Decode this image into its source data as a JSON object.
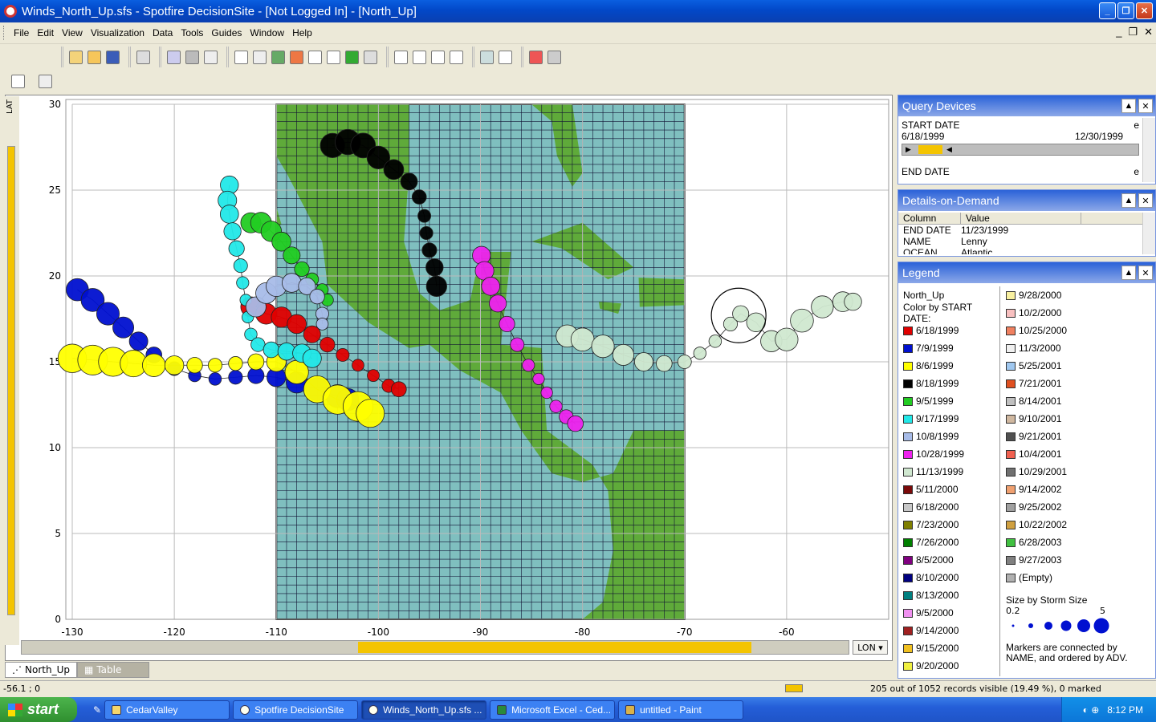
{
  "window": {
    "title": "Winds_North_Up.sfs - Spotfire DecisionSite - [Not Logged In] - [North_Up]"
  },
  "menu": [
    "File",
    "Edit",
    "View",
    "Visualization",
    "Data",
    "Tools",
    "Guides",
    "Window",
    "Help"
  ],
  "axes": {
    "y_label": "LAT",
    "x_label": "LON",
    "y_ticks": [
      "30",
      "25",
      "20",
      "15",
      "10",
      "5",
      "0"
    ],
    "x_ticks": [
      "-130",
      "-120",
      "-110",
      "-100",
      "-90",
      "-80",
      "-70",
      "-60"
    ]
  },
  "tabs": [
    {
      "label": "North_Up"
    },
    {
      "label": "Table"
    }
  ],
  "status": {
    "coord": "-56.1 ; 0",
    "records": "205 out of 1052 records visible (19.49 %), 0 marked"
  },
  "query_devices": {
    "title": "Query Devices",
    "start_label": "START DATE",
    "start_min": "6/18/1999",
    "start_max": "12/30/1999",
    "start_flag": "e",
    "end_label": "END DATE",
    "end_flag": "e"
  },
  "details": {
    "title": "Details-on-Demand",
    "col_header": "Column",
    "val_header": "Value",
    "rows": [
      {
        "c": "END DATE",
        "v": "11/23/1999"
      },
      {
        "c": "NAME",
        "v": "Lenny"
      },
      {
        "c": "OCEAN",
        "v": "Atlantic"
      }
    ]
  },
  "legend": {
    "title": "Legend",
    "view": "North_Up",
    "color_by": "Color by START DATE:",
    "left": [
      {
        "label": "6/18/1999",
        "color": "#e00000"
      },
      {
        "label": "7/9/1999",
        "color": "#0010d0"
      },
      {
        "label": "8/6/1999",
        "color": "#ffff00"
      },
      {
        "label": "8/18/1999",
        "color": "#000000"
      },
      {
        "label": "9/5/1999",
        "color": "#22cc22"
      },
      {
        "label": "9/17/1999",
        "color": "#22e8e8"
      },
      {
        "label": "10/8/1999",
        "color": "#a8bce8"
      },
      {
        "label": "10/28/1999",
        "color": "#ee22ee"
      },
      {
        "label": "11/13/1999",
        "color": "#d0e8d0"
      },
      {
        "label": "5/11/2000",
        "color": "#7a0a0a"
      },
      {
        "label": "6/18/2000",
        "color": "#c8c8c8"
      },
      {
        "label": "7/23/2000",
        "color": "#808000"
      },
      {
        "label": "7/26/2000",
        "color": "#008000"
      },
      {
        "label": "8/5/2000",
        "color": "#800080"
      },
      {
        "label": "8/10/2000",
        "color": "#000080"
      },
      {
        "label": "8/13/2000",
        "color": "#008080"
      },
      {
        "label": "9/5/2000",
        "color": "#f090f0"
      },
      {
        "label": "9/14/2000",
        "color": "#a02020"
      },
      {
        "label": "9/15/2000",
        "color": "#f0c020"
      },
      {
        "label": "9/20/2000",
        "color": "#f0f040"
      }
    ],
    "right": [
      {
        "label": "9/28/2000",
        "color": "#f8f0a0"
      },
      {
        "label": "10/2/2000",
        "color": "#f8c0c0"
      },
      {
        "label": "10/25/2000",
        "color": "#f08060"
      },
      {
        "label": "11/3/2000",
        "color": "#f0f0f0"
      },
      {
        "label": "5/25/2001",
        "color": "#a0c8f0"
      },
      {
        "label": "7/21/2001",
        "color": "#e05020"
      },
      {
        "label": "8/14/2001",
        "color": "#c0c0c0"
      },
      {
        "label": "9/10/2001",
        "color": "#d0b8a0"
      },
      {
        "label": "9/21/2001",
        "color": "#505050"
      },
      {
        "label": "10/4/2001",
        "color": "#f06050"
      },
      {
        "label": "10/29/2001",
        "color": "#707070"
      },
      {
        "label": "9/14/2002",
        "color": "#f0a070"
      },
      {
        "label": "9/25/2002",
        "color": "#a0a0a0"
      },
      {
        "label": "10/22/2002",
        "color": "#d0a040"
      },
      {
        "label": "6/28/2003",
        "color": "#40c040"
      },
      {
        "label": "9/27/2003",
        "color": "#808080"
      },
      {
        "label": "(Empty)",
        "color": "#b0b0b0"
      }
    ],
    "size_by": "Size by Storm Size",
    "size_min": "0.2",
    "size_max": "5",
    "note": "Markers are connected by NAME, and ordered by ADV."
  },
  "taskbar": {
    "start": "start",
    "tasks": [
      {
        "label": "CedarValley"
      },
      {
        "label": "Spotfire DecisionSite"
      },
      {
        "label": "Winds_North_Up.sfs ..."
      },
      {
        "label": "Microsoft Excel - Ced..."
      },
      {
        "label": "untitled - Paint"
      }
    ],
    "clock": "8:12 PM"
  },
  "chart_data": {
    "type": "scatter",
    "xlabel": "LON",
    "ylabel": "LAT",
    "xlim": [
      -130,
      -53
    ],
    "ylim": [
      0,
      30
    ],
    "series": [
      {
        "name": "6/18/1999",
        "color": "#e00000",
        "points": [
          [
            -112.5,
            18.2
          ],
          [
            -111,
            17.8
          ],
          [
            -109.5,
            17.6
          ],
          [
            -108,
            17.2
          ],
          [
            -106.5,
            16.6
          ],
          [
            -105,
            16
          ],
          [
            -103.5,
            15.4
          ],
          [
            -102,
            14.8
          ],
          [
            -100.5,
            14.2
          ],
          [
            -99,
            13.6
          ],
          [
            -98,
            13.4
          ]
        ],
        "size": 0.5
      },
      {
        "name": "7/9/1999",
        "color": "#0010d0",
        "points": [
          [
            -129.5,
            19.2
          ],
          [
            -128,
            18.6
          ],
          [
            -126.5,
            17.8
          ],
          [
            -125,
            17
          ],
          [
            -123.5,
            16.2
          ],
          [
            -122,
            15.4
          ],
          [
            -120,
            14.6
          ],
          [
            -118,
            14.2
          ],
          [
            -116,
            14
          ],
          [
            -114,
            14.1
          ],
          [
            -112,
            14.2
          ],
          [
            -110,
            14.1
          ],
          [
            -108,
            13.8
          ],
          [
            -106,
            13.4
          ],
          [
            -104,
            13
          ],
          [
            -103,
            12.8
          ]
        ],
        "size": 0.6
      },
      {
        "name": "8/6/1999",
        "color": "#ffff00",
        "points": [
          [
            -130,
            15.2
          ],
          [
            -128,
            15.1
          ],
          [
            -126,
            15
          ],
          [
            -124,
            14.9
          ],
          [
            -122,
            14.8
          ],
          [
            -120,
            14.8
          ],
          [
            -118,
            14.8
          ],
          [
            -116,
            14.8
          ],
          [
            -114,
            14.9
          ],
          [
            -112,
            15
          ],
          [
            -110,
            15
          ],
          [
            -108,
            14.4
          ],
          [
            -106,
            13.4
          ],
          [
            -104,
            12.8
          ],
          [
            -102,
            12.4
          ],
          [
            -100.8,
            12
          ]
        ],
        "size": 0.9
      },
      {
        "name": "8/18/1999",
        "color": "#000000",
        "points": [
          [
            -104.5,
            27.6
          ],
          [
            -103,
            27.8
          ],
          [
            -101.5,
            27.6
          ],
          [
            -100,
            26.9
          ],
          [
            -98.5,
            26.2
          ],
          [
            -97,
            25.5
          ],
          [
            -96,
            24.6
          ],
          [
            -95.5,
            23.5
          ],
          [
            -95.3,
            22.5
          ],
          [
            -95,
            21.5
          ],
          [
            -94.5,
            20.5
          ],
          [
            -94.3,
            19.4
          ]
        ],
        "size": 0.7
      },
      {
        "name": "9/5/1999",
        "color": "#22cc22",
        "points": [
          [
            -112.5,
            23.1
          ],
          [
            -111.5,
            23.1
          ],
          [
            -110.5,
            22.6
          ],
          [
            -109.5,
            22
          ],
          [
            -108.5,
            21.2
          ],
          [
            -107.5,
            20.4
          ],
          [
            -106.5,
            19.8
          ],
          [
            -105.5,
            19.2
          ],
          [
            -105,
            18.6
          ]
        ],
        "size": 0.5
      },
      {
        "name": "9/17/1999",
        "color": "#22e8e8",
        "points": [
          [
            -114.6,
            25.3
          ],
          [
            -114.8,
            24.4
          ],
          [
            -114.6,
            23.6
          ],
          [
            -114.3,
            22.6
          ],
          [
            -113.9,
            21.6
          ],
          [
            -113.5,
            20.6
          ],
          [
            -113.3,
            19.6
          ],
          [
            -113,
            18.6
          ],
          [
            -112.8,
            17.6
          ],
          [
            -112.5,
            16.6
          ],
          [
            -111.8,
            16
          ],
          [
            -110.5,
            15.7
          ],
          [
            -109,
            15.6
          ],
          [
            -107.5,
            15.5
          ],
          [
            -106.5,
            15.2
          ]
        ],
        "size": 0.4
      },
      {
        "name": "10/8/1999",
        "color": "#a8bce8",
        "points": [
          [
            -112,
            18.2
          ],
          [
            -111,
            19
          ],
          [
            -110,
            19.4
          ],
          [
            -108.5,
            19.6
          ],
          [
            -107,
            19.4
          ],
          [
            -106,
            18.8
          ],
          [
            -105.5,
            17.8
          ],
          [
            -105.5,
            17.2
          ]
        ],
        "size": 0.5
      },
      {
        "name": "10/28/1999",
        "color": "#ee22ee",
        "points": [
          [
            -89.9,
            21.2
          ],
          [
            -89.6,
            20.3
          ],
          [
            -89,
            19.4
          ],
          [
            -88.3,
            18.4
          ],
          [
            -87.4,
            17.2
          ],
          [
            -86.4,
            16
          ],
          [
            -85.3,
            14.8
          ],
          [
            -84.3,
            14
          ],
          [
            -83.5,
            13.2
          ],
          [
            -82.6,
            12.4
          ],
          [
            -81.6,
            11.8
          ],
          [
            -80.7,
            11.4
          ]
        ],
        "size": 0.4
      },
      {
        "name": "11/13/1999",
        "color": "#d0e8d0",
        "points": [
          [
            -81.5,
            16.5
          ],
          [
            -80,
            16.3
          ],
          [
            -78,
            15.9
          ],
          [
            -76,
            15.4
          ],
          [
            -74,
            15
          ],
          [
            -72,
            14.9
          ],
          [
            -70,
            15
          ],
          [
            -68.5,
            15.5
          ],
          [
            -67,
            16.2
          ],
          [
            -65.5,
            17.2
          ],
          [
            -64.5,
            17.8
          ],
          [
            -63,
            17.3
          ],
          [
            -61.5,
            16.2
          ],
          [
            -60,
            16.3
          ],
          [
            -58.5,
            17.4
          ],
          [
            -56.5,
            18.2
          ],
          [
            -54.5,
            18.5
          ],
          [
            -53.5,
            18.5
          ]
        ],
        "size": 0.6
      }
    ]
  }
}
